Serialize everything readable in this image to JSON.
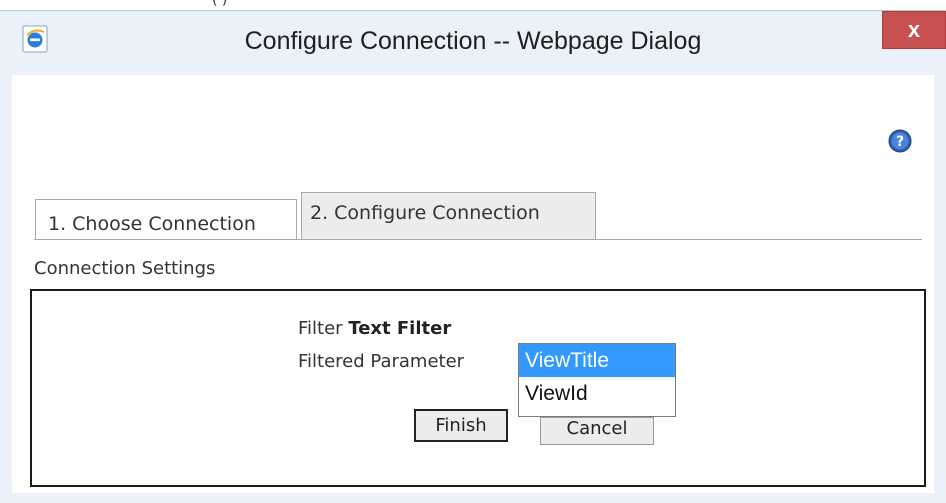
{
  "window": {
    "title": "Configure Connection -- Webpage Dialog",
    "close_label": "x",
    "behind_window_text": "(        )"
  },
  "tabs": [
    {
      "label": "1. Choose Connection",
      "active": false
    },
    {
      "label": "2. Configure Connection",
      "active": true
    }
  ],
  "section": {
    "label": "Connection Settings"
  },
  "settings": {
    "filter_prefix": "Filter",
    "filter_name": "Text Filter",
    "param_label": "Filtered Parameter",
    "param_options": [
      "ViewTitle",
      "ViewId"
    ],
    "param_selected": "ViewTitle"
  },
  "buttons": {
    "finish": "Finish",
    "cancel": "Cancel"
  },
  "colors": {
    "selection": "#3399ff",
    "close": "#c75050",
    "frame": "#eaf1f8"
  },
  "icons": {
    "app": "ie-icon",
    "help": "help-icon",
    "close": "close-icon"
  }
}
